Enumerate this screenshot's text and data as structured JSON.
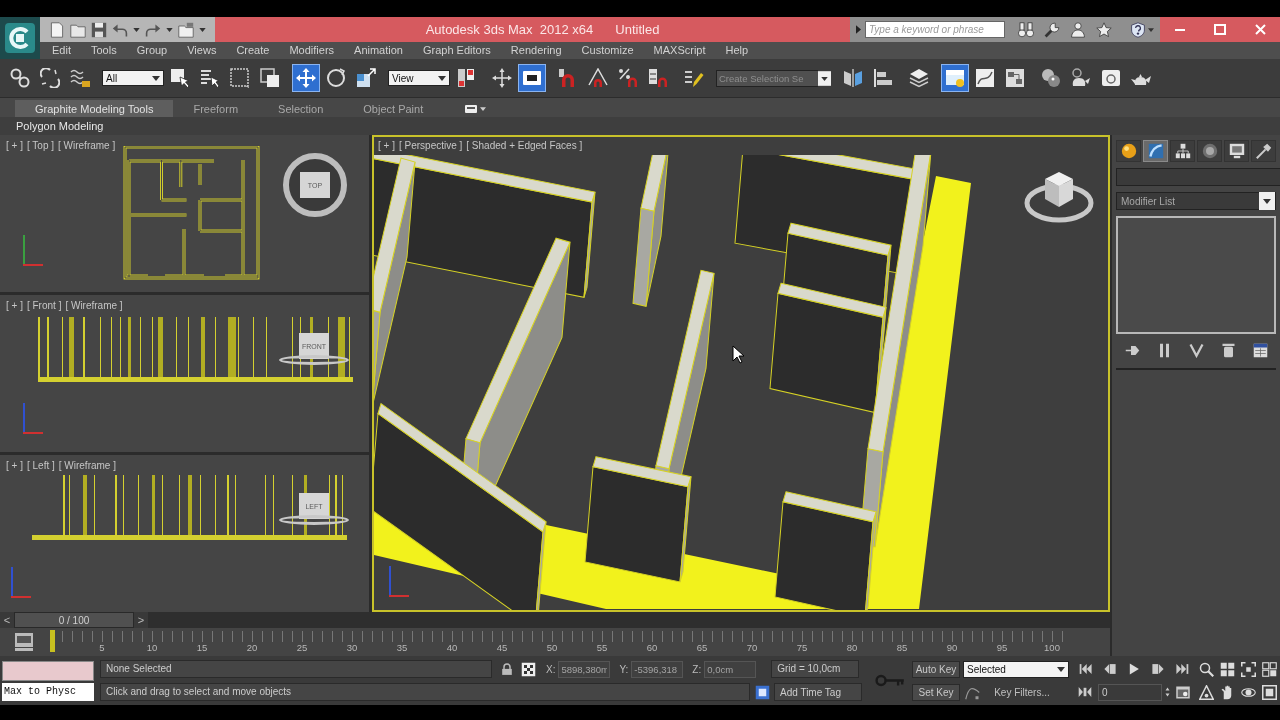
{
  "window": {
    "title": "Autodesk 3ds Max  2012 x64",
    "document": "Untitled"
  },
  "search": {
    "placeholder": "Type a keyword or phrase"
  },
  "menu_bar": [
    "Edit",
    "Tools",
    "Group",
    "Views",
    "Create",
    "Modifiers",
    "Animation",
    "Graph Editors",
    "Rendering",
    "Customize",
    "MAXScript",
    "Help"
  ],
  "main_toolbar": [
    {
      "kind": "tool",
      "on": false
    },
    {
      "kind": "tool",
      "on": false
    },
    {
      "kind": "tool",
      "on": false
    },
    {
      "kind": "dropdown",
      "value": "All"
    },
    {
      "kind": "tool",
      "on": false
    },
    {
      "kind": "tool",
      "on": false
    },
    {
      "kind": "tool",
      "on": false
    },
    {
      "kind": "tool",
      "on": false
    },
    {
      "kind": "tool",
      "on": true
    },
    {
      "kind": "tool",
      "on": false
    },
    {
      "kind": "tool",
      "on": false
    },
    {
      "kind": "dropdown",
      "value": "View"
    },
    {
      "kind": "tool",
      "on": false
    },
    {
      "kind": "tool",
      "on": false
    },
    {
      "kind": "tool",
      "on": true
    },
    {
      "kind": "tool",
      "on": false
    },
    {
      "kind": "tool",
      "on": false
    },
    {
      "kind": "tool",
      "on": false
    },
    {
      "kind": "tool",
      "on": false
    },
    {
      "kind": "tool",
      "on": false
    },
    {
      "kind": "combo",
      "placeholder": "Create Selection Se"
    },
    {
      "kind": "tool",
      "on": false
    },
    {
      "kind": "tool",
      "on": false
    },
    {
      "kind": "tool",
      "on": false
    },
    {
      "kind": "tool",
      "on": true
    },
    {
      "kind": "tool",
      "on": false
    },
    {
      "kind": "tool",
      "on": false
    },
    {
      "kind": "tool",
      "on": false
    },
    {
      "kind": "tool",
      "on": false
    },
    {
      "kind": "tool",
      "on": false
    },
    {
      "kind": "tool",
      "on": false
    }
  ],
  "ribbon": {
    "tabs": [
      {
        "label": "Graphite Modeling Tools",
        "selected": true
      },
      {
        "label": "Freeform",
        "selected": false
      },
      {
        "label": "Selection",
        "selected": false
      },
      {
        "label": "Object Paint",
        "selected": false
      }
    ],
    "panel": "Polygon Modeling"
  },
  "viewports": [
    {
      "kind": "plan",
      "active": false,
      "menus": [
        "[ + ]",
        "[ Top ]",
        "[ Wireframe ]"
      ],
      "cube_label": "TOP"
    },
    {
      "kind": "front",
      "active": false,
      "menus": [
        "[ + ]",
        "[ Front ]",
        "[ Wireframe ]"
      ],
      "cube_label": "FRONT"
    },
    {
      "kind": "side",
      "active": false,
      "menus": [
        "[ + ]",
        "[ Left ]",
        "[ Wireframe ]"
      ],
      "cube_label": "LEFT"
    },
    {
      "kind": "perspective",
      "active": true,
      "menus": [
        "[ + ]",
        "[ Perspective ]",
        "[ Shaded + Edged Faces ]"
      ]
    }
  ],
  "command_panel": {
    "tabs": [
      {
        "selected": false
      },
      {
        "selected": true
      },
      {
        "selected": false
      },
      {
        "selected": false
      },
      {
        "selected": false
      },
      {
        "selected": false
      }
    ],
    "modifier_list": "Modifier List"
  },
  "time_slider": {
    "prev": "<",
    "label": "0 / 100",
    "next": ">",
    "level": 0
  },
  "track_bar": {
    "labels": [
      "5",
      "10",
      "15",
      "20",
      "25",
      "30",
      "35",
      "40",
      "45",
      "50",
      "55",
      "60",
      "65",
      "70",
      "75",
      "80",
      "85",
      "90",
      "95",
      "100"
    ]
  },
  "status": {
    "listener_output": "Max to Physc",
    "selection": "None Selected",
    "prompt": "Click and drag to select and move objects",
    "coordinates": [
      {
        "axis": "X:",
        "value": "5898,380m",
        "disabled": true
      },
      {
        "axis": "Y:",
        "value": "-5396,318",
        "disabled": true
      },
      {
        "axis": "Z:",
        "value": "0,0cm",
        "disabled": true
      }
    ],
    "grid": "Grid = 10,0cm",
    "time_tag": "Add Time Tag"
  },
  "animation": {
    "auto_key": "Auto Key",
    "key_set": "Selected",
    "set_key": "Set Key",
    "key_filters": "Key Filters...",
    "frame": "0"
  }
}
